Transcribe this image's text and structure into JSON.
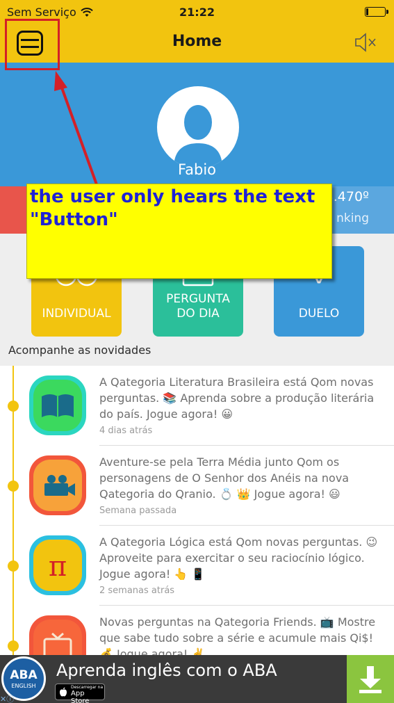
{
  "status_bar": {
    "carrier": "Sem Serviço",
    "time": "21:22",
    "battery_level": 0.12
  },
  "nav": {
    "title": "Home",
    "menu_icon": "menu-icon",
    "mute_icon": "speaker-muted-icon"
  },
  "profile": {
    "name": "Fabio",
    "avatar_icon": "user-silhouette-icon"
  },
  "stats": {
    "ranking_value": "3.470º",
    "ranking_label": "nking"
  },
  "modes": [
    {
      "label": "INDIVIDUAL",
      "icon": "people-icon",
      "color": "#f2c40f"
    },
    {
      "label": "PERGUNTA DO DIA",
      "icon": "calendar-icon",
      "color": "#2bbf9a"
    },
    {
      "label": "DUELO",
      "icon": "swords-icon",
      "color": "#3a98d8"
    }
  ],
  "feed": {
    "title": "Acompanhe as novidades",
    "items": [
      {
        "text": "A Qategoria Literatura Brasileira está Qom novas perguntas. 📚 Aprenda sobre a produção literária do país. Jogue agora! 😀",
        "time": "4 dias atrás",
        "icon": "book-icon"
      },
      {
        "text": "Aventure-se pela Terra Média junto Qom os personagens de O Senhor dos Anéis na nova Qategoria do Qranio. 💍 👑 Jogue agora! 😃",
        "time": "Semana passada",
        "icon": "movie-camera-icon"
      },
      {
        "text": "A Qategoria Lógica está Qom novas perguntas. 😉 Aproveite para exercitar o seu raciocínio lógico. Jogue agora! 👆 📱",
        "time": "2 semanas atrás",
        "icon": "pi-icon"
      },
      {
        "text": "Novas perguntas na Qategoria Friends. 📺 Mostre que sabe tudo sobre a série e acumule mais Qi$! 💰 Jogue agora! ✌️",
        "time": "",
        "icon": "tv-icon"
      }
    ]
  },
  "ad": {
    "logo_text": "ABA",
    "logo_sub": "ENGLISH",
    "text": "Aprenda inglês com o ABA",
    "store_line1": "Descarregar na",
    "store_line2": "App Store",
    "download_icon": "download-icon"
  },
  "annotation": {
    "text": "the user only hears the text \"Button\""
  }
}
